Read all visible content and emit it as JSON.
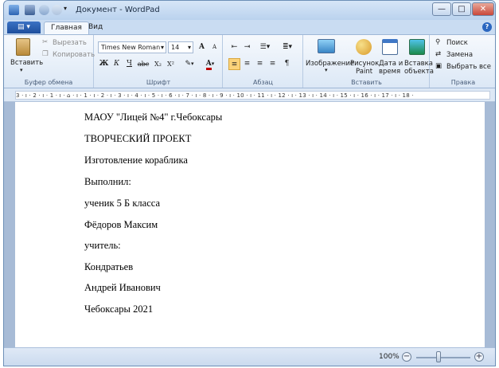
{
  "window": {
    "title": "Документ - WordPad",
    "min": "—",
    "max": "□",
    "close": "✕"
  },
  "tabs": {
    "file": "▤ ▾",
    "home": "Главная",
    "view": "Вид",
    "help": "?"
  },
  "clipboard": {
    "paste": "Вставить",
    "cut": "Вырезать",
    "copy": "Копировать",
    "group": "Буфер обмена"
  },
  "font": {
    "family": "Times New Roman",
    "size": "14",
    "bold": "Ж",
    "italic": "К",
    "underline": "Ч",
    "strike": "abc",
    "sub": "X₂",
    "sup": "X²",
    "grow": "A",
    "shrink": "A",
    "color": "A",
    "group": "Шрифт"
  },
  "paragraph": {
    "group": "Абзац"
  },
  "insert": {
    "image": "Изображение",
    "paint_line1": "Рисунок",
    "paint_line2": "Paint",
    "datetime_line1": "Дата и",
    "datetime_line2": "время",
    "object_line1": "Вставка",
    "object_line2": "объекта",
    "group": "Вставить"
  },
  "editing": {
    "find": "Поиск",
    "replace": "Замена",
    "select_all": "Выбрать все",
    "group": "Правка"
  },
  "ruler": {
    "text": "3 · ı · 2 · ı · 1 · ı · ⌂ · ı · 1 · ı · 2 · ı · 3 · ı · 4 · ı · 5 · ı · 6 · ı · 7 · ı · 8 · ı · 9 · ı · 10 · ı · 11 · ı · 12 · ı · 13 · ı · 14 · ı · 15 · ı · 16 · ı · 17 · ı · 18 ·"
  },
  "document": {
    "lines": [
      "МАОУ \"Лицей №4\" г.Чебоксары",
      "ТВОРЧЕСКИЙ ПРОЕКТ",
      "Изготовление кораблика",
      "Выполнил:",
      "ученик 5 Б класса",
      "Фёдоров Максим",
      "учитель:",
      "Кондратьев",
      "Андрей Иванович",
      "Чебоксары 2021"
    ]
  },
  "status": {
    "zoom": "100%",
    "zoom_out": "−",
    "zoom_in": "+"
  },
  "colors": {
    "accent": "#2b67c0",
    "title_bar": "#c9dcf2"
  }
}
